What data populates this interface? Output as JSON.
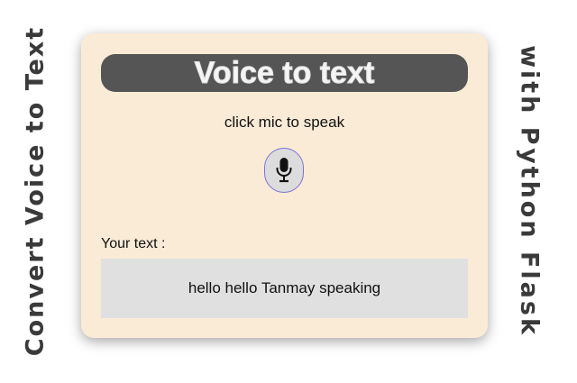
{
  "banner": {
    "left_text": "Convert Voice to Text",
    "right_text": "with Python Flask"
  },
  "app": {
    "title": "Voice to text",
    "hint": "click mic to speak",
    "mic_icon": "microphone-icon",
    "output_label": "Your text :",
    "output_text": "hello hello Tanmay speaking"
  },
  "colors": {
    "card_background": "#faebd7",
    "title_bar": "#555555",
    "output_box": "#e0e0e0",
    "mic_border": "#7b72d8"
  }
}
